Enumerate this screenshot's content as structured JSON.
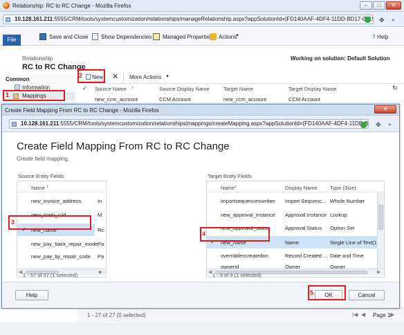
{
  "outer_window": {
    "title": "Relationship: RC to RC Change - Mozilla Firefox",
    "url_host": "10.128.161.211",
    "url_rest": ":5555/CRM/tools/systemcustomization/relationships/manageRelationship.aspx?appSolutionId={FD140AAF-4DF4-11DD-BD17-0019B93122"
  },
  "ribbon": {
    "file_label": "File",
    "save_close_label": "Save and Close",
    "show_deps_label": "Show Dependencies",
    "managed_props_label": "Managed Properties",
    "actions_label": "Actions",
    "help_label": "Help"
  },
  "entity": {
    "type_label": "Relationship",
    "title": "RC to RC Change",
    "solution_text": "Working on solution: Default Solution"
  },
  "nav": {
    "section": "Common",
    "items": [
      {
        "label": "Information"
      },
      {
        "label": "Mappings"
      }
    ]
  },
  "grid_toolbar": {
    "new_label": "New",
    "more_actions_label": "More Actions"
  },
  "outer_grid": {
    "columns": [
      "Source Name",
      "Source Display Name",
      "Target Name",
      "Target Display Name"
    ],
    "rows": [
      {
        "source_name": "new_ccm_account",
        "source_display": "CCM Account",
        "target_name": "new_ccm_account",
        "target_display": "CCM Account"
      }
    ],
    "footer_status": "1 - 27 of 27 (0 selected)",
    "page_label": "Page 1"
  },
  "dialog_window": {
    "title": "Create Field Mapping From RC to RC Change - Mozilla Firefox",
    "url_host": "10.128.161.211",
    "url_rest": ":5555/CRM/tools/systemcustomization/relationships/mappings/createMapping.aspx?appSolutionId={FD140AAF-4DF4-11DD-BD17-0"
  },
  "dialog": {
    "heading": "Create Field Mapping From RC to RC Change",
    "subheading": "Create field mapping.",
    "source_panel_title": "Source Entity Fields",
    "target_panel_title": "Target Entity Fields",
    "source_columns": [
      "Name"
    ],
    "source_rows": [
      {
        "name": "new_invoice_address",
        "extra": "In"
      },
      {
        "name": "new_main_rcid",
        "extra": "M"
      },
      {
        "name": "new_name",
        "extra": "Rc",
        "selected": true
      },
      {
        "name": "new_pay_back_repair_mode",
        "extra": "Pa"
      },
      {
        "name": "new_pay_by_repair_code",
        "extra": "Pa"
      },
      {
        "name": "new_pay_by_repair_code",
        "extra": "Pa"
      }
    ],
    "source_status": "1 - 57 of 57 (1 selected)",
    "target_columns": [
      "Name",
      "Display Name",
      "Type (Size)"
    ],
    "target_rows": [
      {
        "name": "importsequencenumber",
        "display": "Import Sequenc...",
        "type": "Whole Number"
      },
      {
        "name": "new_approval_instance",
        "display": "Approval Instance",
        "type": "Lookup"
      },
      {
        "name": "new_approval_status",
        "display": "Approval Status",
        "type": "Option Set"
      },
      {
        "name": "new_name",
        "display": "Name",
        "type": "Single Line of Text(100)",
        "selected": true
      },
      {
        "name": "overriddencreatedon",
        "display": "Record Created ...",
        "type": "Date and Time"
      },
      {
        "name": "ownerid",
        "display": "Owner",
        "type": "Owner"
      }
    ],
    "target_status": "1 - 9 of 9 (1 selected)",
    "help_label": "Help",
    "ok_label": "OK",
    "cancel_label": "Cancel"
  },
  "steps": [
    "1",
    "2",
    "3",
    "4",
    "5"
  ],
  "colors": {
    "annotation_red": "#e0191b",
    "selection": "#cde2f7",
    "file_tab": "#2a62b0",
    "title_blue": "#dfe8f3"
  }
}
